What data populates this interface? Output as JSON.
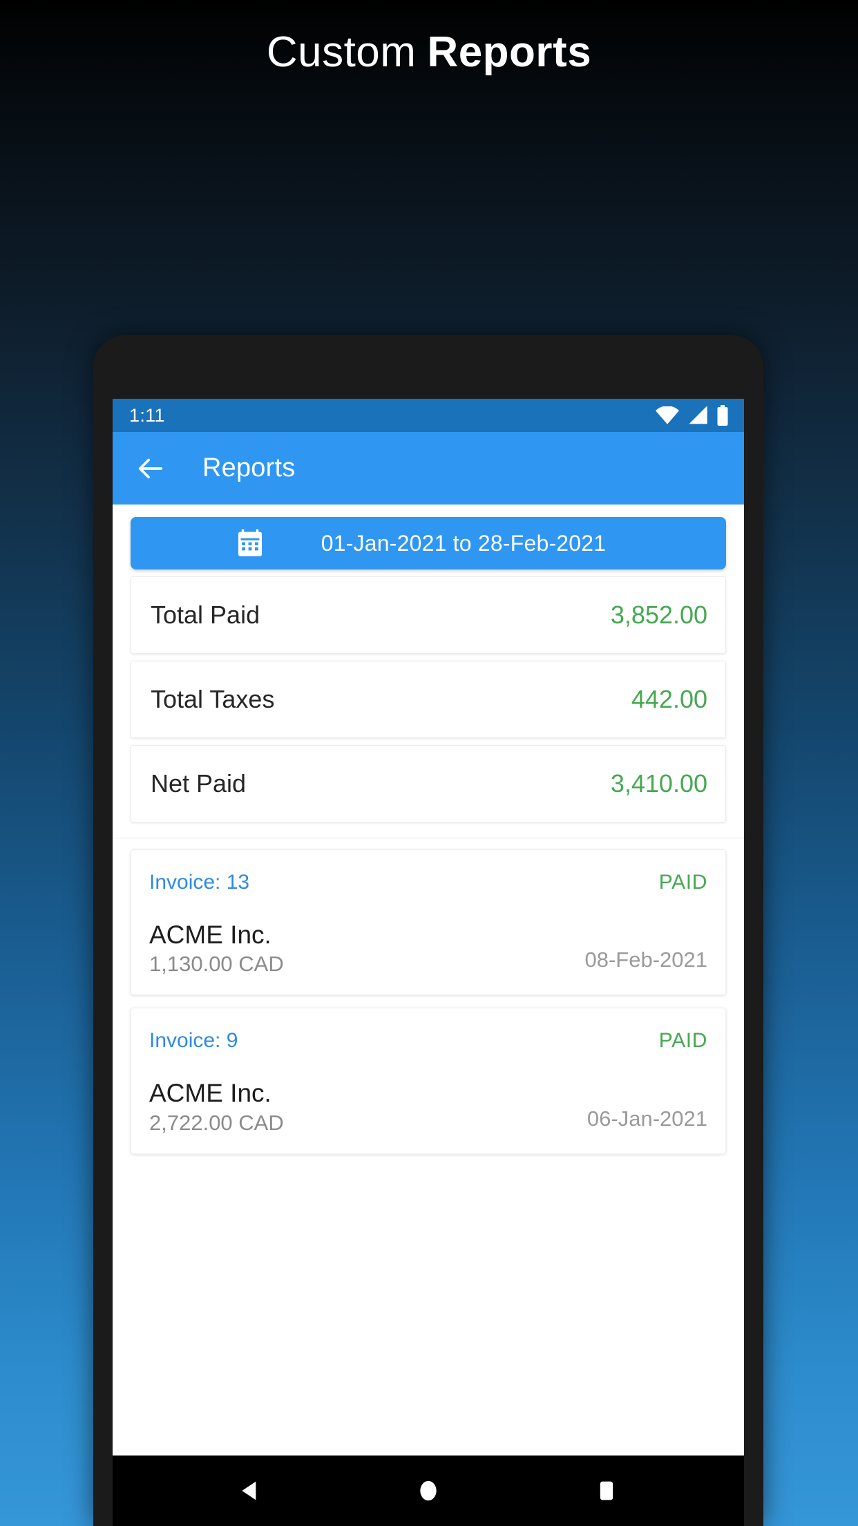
{
  "hero": {
    "title_light": "Custom",
    "title_bold": "Reports"
  },
  "phone": {
    "status_bar": {
      "time": "1:11",
      "icons": [
        "wifi-icon",
        "cell-signal-icon",
        "battery-icon"
      ]
    },
    "app_bar": {
      "back_icon": "back-arrow-icon",
      "title": "Reports"
    },
    "date_range": {
      "icon": "calendar-icon",
      "label": "01-Jan-2021 to 28-Feb-2021"
    },
    "summary": [
      {
        "label": "Total Paid",
        "value": "3,852.00"
      },
      {
        "label": "Total Taxes",
        "value": "442.00"
      },
      {
        "label": "Net Paid",
        "value": "3,410.00"
      }
    ],
    "invoices": [
      {
        "number": "Invoice: 13",
        "status": "PAID",
        "client": "ACME Inc.",
        "amount": "1,130.00 CAD",
        "date": "08-Feb-2021"
      },
      {
        "number": "Invoice: 9",
        "status": "PAID",
        "client": "ACME Inc.",
        "amount": "2,722.00 CAD",
        "date": "06-Jan-2021"
      }
    ],
    "nav_bar": {
      "back": "nav-back-icon",
      "home": "nav-home-icon",
      "recents": "nav-recents-icon"
    }
  },
  "colors": {
    "accent_blue": "#2f96f2",
    "status_bar_blue": "#1a72ba",
    "money_green": "#46a852",
    "link_blue": "#2f8ae0",
    "muted_gray": "#9a9a9a"
  }
}
